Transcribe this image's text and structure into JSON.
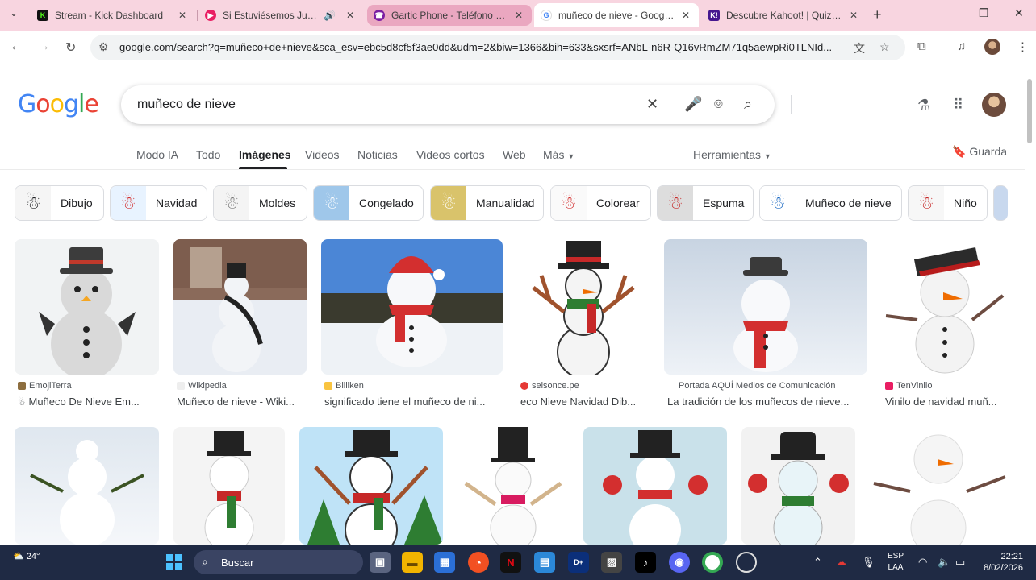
{
  "browser": {
    "tabs": [
      {
        "title": "Stream - Kick Dashboard",
        "favicon": "kick-icon",
        "color": "#53fc18"
      },
      {
        "title": "Si Estuviésemos Juntos A",
        "favicon": "youtube-icon",
        "color": "#e91e63"
      },
      {
        "title": "Gartic Phone - Teléfono Des",
        "favicon": "gartic-icon",
        "color": "#7b1fa2"
      },
      {
        "title": "muñeco de nieve - Google S",
        "favicon": "google-icon",
        "color": "#4285f4"
      },
      {
        "title": "Descubre Kahoot! | Quizzes",
        "favicon": "kahoot-icon",
        "color": "#46178f"
      }
    ],
    "url": "google.com/search?q=muñeco+de+nieve&sca_esv=ebc5d8cf5f3ae0dd&udm=2&biw=1366&bih=633&sxsrf=ANbL-n6R-Q16vRmZM71q5aewpRi0TLNId..."
  },
  "google": {
    "logo": "Google",
    "query": "muñeco de nieve",
    "tabs": [
      "Modo IA",
      "Todo",
      "Imágenes",
      "Videos",
      "Noticias",
      "Videos cortos",
      "Web",
      "Más"
    ],
    "tools": "Herramientas",
    "save": "Guarda"
  },
  "chips": [
    "Dibujo",
    "Navidad",
    "Moldes",
    "Congelado",
    "Manualidad",
    "Colorear",
    "Espuma",
    "Muñeco de nieve",
    "Niño"
  ],
  "results": [
    {
      "source": "EmojiTerra",
      "caption": "Muñeco De Nieve Em..."
    },
    {
      "source": "Wikipedia",
      "caption": "Muñeco de nieve - Wiki..."
    },
    {
      "source": "Billiken",
      "caption": "significado tiene el muñeco de ni..."
    },
    {
      "source": "seisonce.pe",
      "caption": "eco Nieve Navidad Dib..."
    },
    {
      "source": "Portada AQUÍ Medios de Comunicación",
      "caption": "La tradición de los muñecos de nieve..."
    },
    {
      "source": "TenVinilo",
      "caption": "Vinilo de navidad muñ..."
    }
  ],
  "taskbar": {
    "temp": "24°",
    "search": "Buscar",
    "lang1": "ESP",
    "lang2": "LAA",
    "time": "22:21",
    "date": "8/02/2026"
  }
}
